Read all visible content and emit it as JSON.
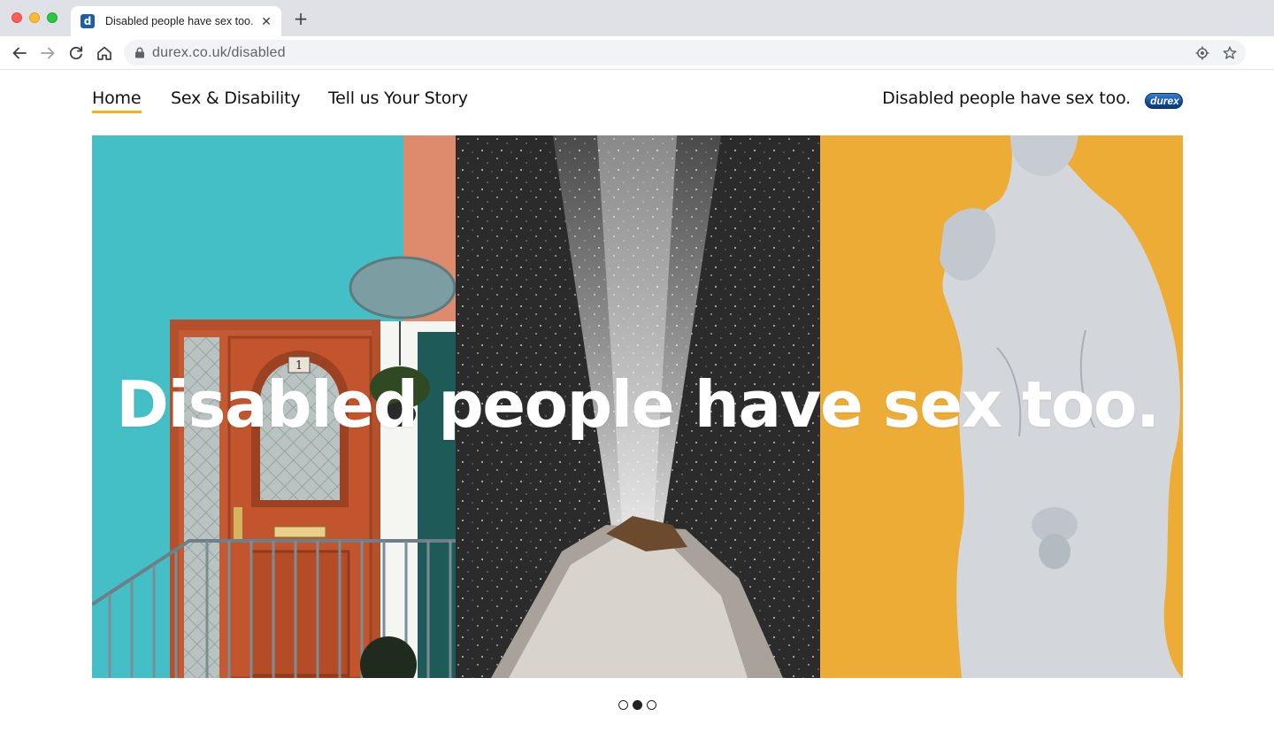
{
  "browser": {
    "tab": {
      "favicon_letter": "d",
      "title": "Disabled people have sex too.",
      "close_glyph": "✕"
    },
    "new_tab_glyph": "+",
    "url": "durex.co.uk/disabled",
    "icons": [
      "back-arrow-icon",
      "forward-arrow-icon",
      "reload-icon",
      "home-icon",
      "lock-icon",
      "location-target-icon",
      "star-icon"
    ]
  },
  "site": {
    "nav": {
      "items": [
        {
          "label": "Home",
          "active": true
        },
        {
          "label": "Sex & Disability",
          "active": false
        },
        {
          "label": "Tell us Your Story",
          "active": false
        }
      ]
    },
    "tagline": "Disabled people have sex too.",
    "logo_text": "durex",
    "accent_color": "#f4b21d",
    "logo_color": "#0f4d9e"
  },
  "hero": {
    "title": "Disabled people have sex too.",
    "panels": [
      "front-door-image",
      "geyser-image",
      "statue-image"
    ],
    "house_number": "1"
  },
  "carousel": {
    "slide_count": 3,
    "active_index": 1
  }
}
